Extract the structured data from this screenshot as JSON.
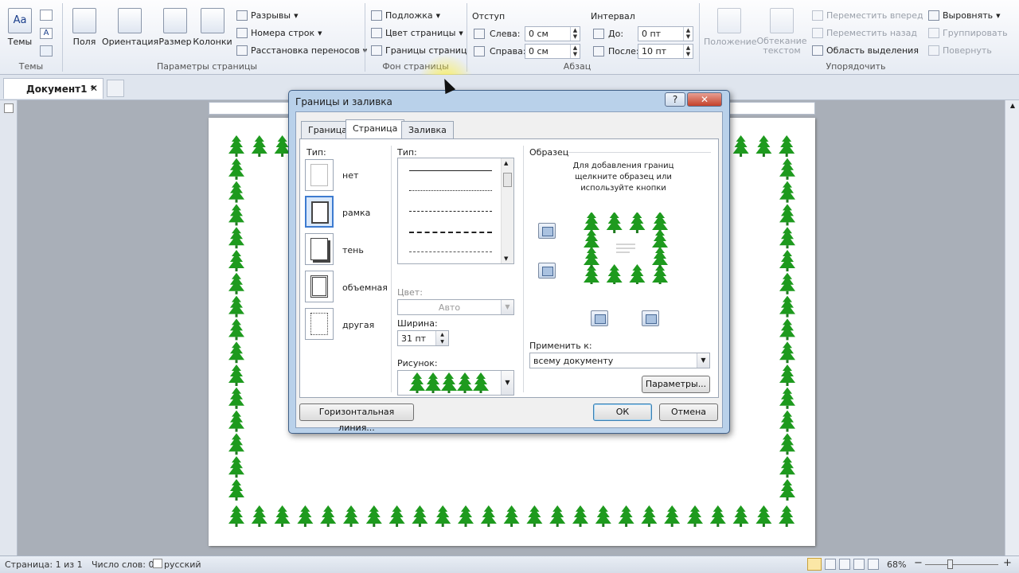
{
  "ribbon": {
    "themes": {
      "button_label": "Темы",
      "group_label": "Темы"
    },
    "page_setup": {
      "margins": "Поля",
      "orientation": "Ориентация",
      "size": "Размер",
      "columns": "Колонки",
      "breaks": "Разрывы",
      "line_numbers": "Номера строк",
      "hyphenation": "Расстановка переносов",
      "group_label": "Параметры страницы"
    },
    "page_background": {
      "watermark": "Подложка",
      "page_color": "Цвет страницы",
      "page_borders": "Границы страниц",
      "group_label": "Фон страницы"
    },
    "paragraph": {
      "indent_title": "Отступ",
      "left_label": "Слева:",
      "left_value": "0 см",
      "right_label": "Справа:",
      "right_value": "0 см",
      "spacing_title": "Интервал",
      "before_label": "До:",
      "before_value": "0 пт",
      "after_label": "После:",
      "after_value": "10 пт",
      "group_label": "Абзац"
    },
    "arrange": {
      "position": "Положение",
      "wrap_text_line1": "Обтекание",
      "wrap_text_line2": "текстом",
      "bring_forward": "Переместить вперед",
      "send_backward": "Переместить назад",
      "selection_pane": "Область выделения",
      "align": "Выровнять",
      "group": "Группировать",
      "rotate": "Повернуть",
      "group_label": "Упорядочить"
    }
  },
  "document_tab": {
    "title": "Документ1 *"
  },
  "dialog": {
    "title": "Границы и заливка",
    "tabs": [
      "Граница",
      "Страница",
      "Заливка"
    ],
    "active_tab": "Страница",
    "type_label": "Тип:",
    "types": [
      "нет",
      "рамка",
      "тень",
      "объемная",
      "другая"
    ],
    "selected_type": "рамка",
    "line_type_label": "Тип:",
    "color_label": "Цвет:",
    "color_value": "Авто",
    "width_label": "Ширина:",
    "width_value": "31 пт",
    "art_label": "Рисунок:",
    "preview_title": "Образец",
    "preview_hint": "Для добавления границ щелкните образец или используйте кнопки",
    "apply_to_label": "Применить к:",
    "apply_to_value": "всему документу",
    "options_button": "Параметры...",
    "horizontal_line_button": "Горизонтальная линия...",
    "ok_button": "ОК",
    "cancel_button": "Отмена"
  },
  "status_bar": {
    "page": "Страница: 1 из 1",
    "words": "Число слов: 0",
    "language": "русский",
    "zoom": "68%"
  },
  "colors": {
    "tree_green": "#1e9a1e",
    "selection_blue": "#3d7bd0"
  }
}
